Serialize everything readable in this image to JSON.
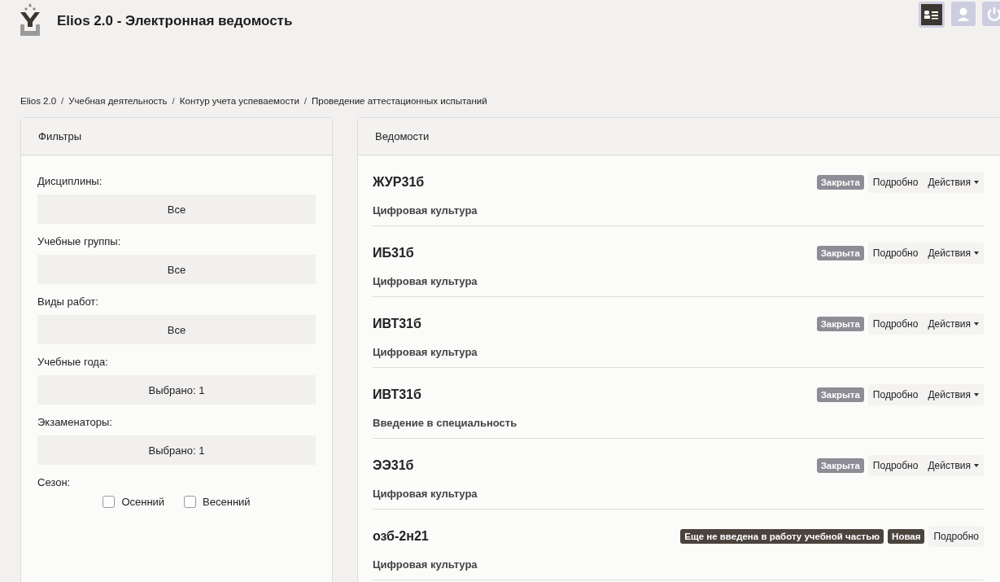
{
  "header": {
    "title": "Elios 2.0 - Электронная ведомость"
  },
  "breadcrumb_separator": "/",
  "breadcrumb": [
    "Elios 2.0",
    "Учебная деятельность",
    "Контур учета успеваемости",
    "Проведение аттестационных испытаний"
  ],
  "filters": {
    "title": "Фильтры",
    "selects": [
      {
        "label": "Дисциплины:",
        "value": "Все"
      },
      {
        "label": "Учебные группы:",
        "value": "Все"
      },
      {
        "label": "Виды работ:",
        "value": "Все"
      },
      {
        "label": "Учебные года:",
        "value": "Выбрано: 1"
      },
      {
        "label": "Экзаменаторы:",
        "value": "Выбрано: 1"
      }
    ],
    "season": {
      "label": "Сезон:",
      "options": [
        {
          "label": "Осенний",
          "checked": false
        },
        {
          "label": "Весенний",
          "checked": false
        }
      ]
    }
  },
  "sheets": {
    "title": "Ведомости",
    "items": [
      {
        "code": "ЖУР31б",
        "subject": "Цифровая культура",
        "badges": [
          {
            "text": "Закрыта",
            "kind": "closed"
          }
        ],
        "details": "Подробно",
        "actions": "Действия"
      },
      {
        "code": "ИБ31б",
        "subject": "Цифровая культура",
        "badges": [
          {
            "text": "Закрыта",
            "kind": "closed"
          }
        ],
        "details": "Подробно",
        "actions": "Действия"
      },
      {
        "code": "ИВТ31б",
        "subject": "Цифровая культура",
        "badges": [
          {
            "text": "Закрыта",
            "kind": "closed"
          }
        ],
        "details": "Подробно",
        "actions": "Действия"
      },
      {
        "code": "ИВТ31б",
        "subject": "Введение в специальность",
        "badges": [
          {
            "text": "Закрыта",
            "kind": "closed"
          }
        ],
        "details": "Подробно",
        "actions": "Действия"
      },
      {
        "code": "ЭЭ31б",
        "subject": "Цифровая культура",
        "badges": [
          {
            "text": "Закрыта",
            "kind": "closed"
          }
        ],
        "details": "Подробно",
        "actions": "Действия"
      },
      {
        "code": "озб-2н21",
        "subject": "Цифровая культура",
        "badges": [
          {
            "text": "Еще не введена в работу учебной частью",
            "kind": "notice"
          },
          {
            "text": "Новая",
            "kind": "new"
          }
        ],
        "details": "Подробно"
      }
    ]
  }
}
